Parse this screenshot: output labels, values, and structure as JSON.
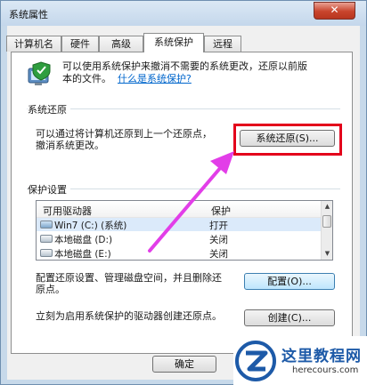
{
  "window": {
    "title": "系统属性",
    "close_glyph": "✕"
  },
  "tabs": [
    {
      "label": "计算机名",
      "active": false
    },
    {
      "label": "硬件",
      "active": false
    },
    {
      "label": "高级",
      "active": false
    },
    {
      "label": "系统保护",
      "active": true
    },
    {
      "label": "远程",
      "active": false
    }
  ],
  "intro": {
    "line1": "可以使用系统保护来撤消不需要的系统更改，还原以前版",
    "line2_prefix": "本的文件。",
    "link": "什么是系统保护?"
  },
  "restore_section": {
    "title": "系统还原",
    "desc_line1": "可以通过将计算机还原到上一个还原点，",
    "desc_line2": "撤消系统更改。",
    "button": "系统还原(S)..."
  },
  "protection_section": {
    "title": "保护设置",
    "columns": [
      "可用驱动器",
      "保护"
    ],
    "drives": [
      {
        "name": "Win7 (C:) (系统)",
        "protection": "打开",
        "icon": "win7-drive-icon"
      },
      {
        "name": "本地磁盘 (D:)",
        "protection": "关闭",
        "icon": "disk-icon"
      },
      {
        "name": "本地磁盘 (E:)",
        "protection": "关闭",
        "icon": "disk-icon"
      }
    ],
    "configure_desc_line1": "配置还原设置、管理磁盘空间，并且删除还",
    "configure_desc_line2": "原点。",
    "configure_button": "配置(O)...",
    "create_desc": "立刻为启用系统保护的驱动器创建还原点。",
    "create_button": "创建(C)..."
  },
  "footer": {
    "ok_button": "确定"
  },
  "watermark": {
    "name": "这里教程网",
    "url": "herecours.com"
  },
  "colors": {
    "highlight_box": "#e3001b",
    "arrow": "#e23ee8",
    "link": "#0066cc"
  }
}
